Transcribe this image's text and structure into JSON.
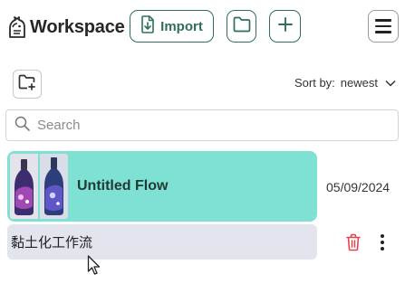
{
  "header": {
    "brand_name": "Workspace",
    "import_label": "Import"
  },
  "toolbar": {
    "sort_label": "Sort by:",
    "sort_value": "newest"
  },
  "search": {
    "placeholder": "Search"
  },
  "items": [
    {
      "type": "flow",
      "title": "Untitled Flow",
      "date": "05/09/2024"
    },
    {
      "type": "folder",
      "title": "黏土化工作流"
    }
  ],
  "colors": {
    "accent": "#2f6f5a",
    "flow_row_bg": "#7fe0d4",
    "folder_row_bg": "#e2e5ee",
    "delete_icon": "#e0454f"
  },
  "icons": [
    "brand-logo-icon",
    "import-file-icon",
    "folder-icon",
    "plus-icon",
    "hamburger-menu-icon",
    "new-folder-icon",
    "chevron-down-icon",
    "search-icon",
    "trash-icon",
    "kebab-menu-icon",
    "mouse-cursor"
  ]
}
